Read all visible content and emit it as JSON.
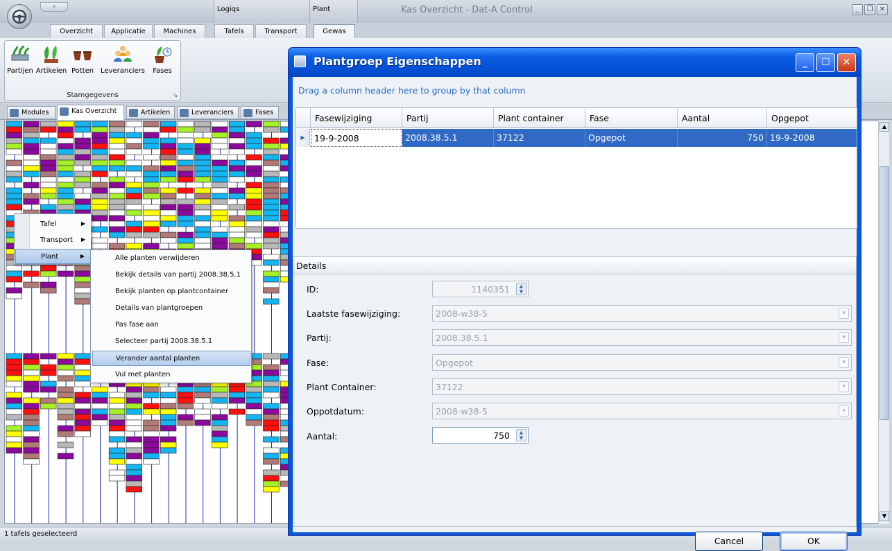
{
  "app": {
    "title": "Kas Overzicht - Dat-A Control",
    "qat_label": "▿",
    "context_groups": [
      "Logiqs",
      "Plant"
    ]
  },
  "ribbon": {
    "tabs": [
      "Overzicht",
      "Applicatie",
      "Machines",
      "Tafels",
      "Transport",
      "Gewas"
    ],
    "active_tab": "Gewas",
    "group": {
      "label": "Stamgegevens",
      "buttons": [
        "Partijen",
        "Artikelen",
        "Potten",
        "Leveranciers",
        "Fases"
      ]
    }
  },
  "doc_tabs": [
    "Modules",
    "Kas Overzicht",
    "Artikelen",
    "Leveranciers",
    "Fases"
  ],
  "context_menu": {
    "main": [
      "Tafel",
      "Transport",
      "Plant"
    ],
    "sub": [
      "Alle planten verwijderen",
      "Bekijk details van partij 2008.38.5.1",
      "Bekijk planten op plantcontainer",
      "Details van plantgroepen",
      "Pas fase aan",
      "Selecteer partij 2008.38.5.1",
      "Verander aantal planten",
      "Vul met planten"
    ],
    "highlighted_sub": "Verander aantal planten"
  },
  "dialog": {
    "title": "Plantgroep Eigenschappen",
    "group_hint": "Drag a column header here to group by that column",
    "columns": [
      "Fasewijziging",
      "Partij",
      "Plant container",
      "Fase",
      "Aantal",
      "Opgepot"
    ],
    "rows": [
      [
        "19-9-2008",
        "2008.38.5.1",
        "37122",
        "Opgepot",
        "750",
        "19-9-2008"
      ]
    ],
    "details": {
      "header": "Details",
      "fields": [
        {
          "label": "ID:",
          "value": "1140351"
        },
        {
          "label": "Laatste fasewijziging:",
          "value": "2008-w38-5"
        },
        {
          "label": "Partij:",
          "value": "2008.38.5.1"
        },
        {
          "label": "Fase:",
          "value": "Opgepot"
        },
        {
          "label": "Plant Container:",
          "value": "37122"
        },
        {
          "label": "Oppotdatum:",
          "value": "2008-w38-5"
        },
        {
          "label": "Aantal:",
          "value": "750"
        }
      ]
    },
    "buttons": {
      "cancel": "Cancel",
      "ok": "OK"
    }
  },
  "status": {
    "text": "1 tafels geselecteerd"
  },
  "colors": {
    "purple": "#8b0a9b",
    "cyan": "#16b4f0",
    "yellow": "#ffff00",
    "green": "#a6f02a",
    "red": "#ff1010",
    "brown": "#b07a78",
    "gray": "#b8b8b8",
    "xp_blue": "#0b57d8",
    "selection": "#316ac5"
  }
}
